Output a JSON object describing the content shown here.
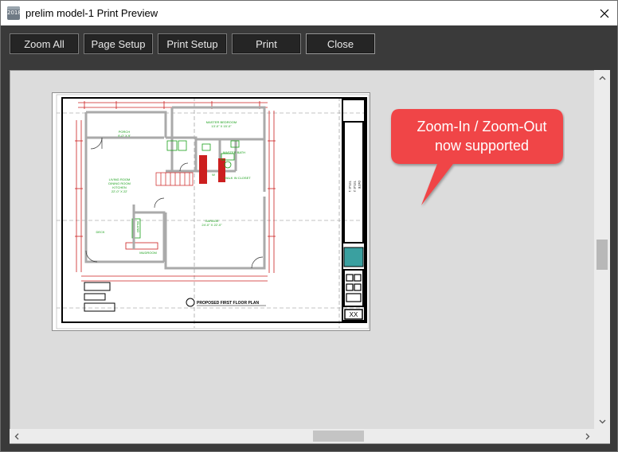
{
  "window": {
    "title": "prelim model-1 Print Preview",
    "app_icon_text": "2018"
  },
  "toolbar": {
    "zoom_all": "Zoom All",
    "page_setup": "Page Setup",
    "print_setup": "Print Setup",
    "print": "Print",
    "close": "Close"
  },
  "plan": {
    "rooms": {
      "porch": "PORCH",
      "porch_size": "9'-0\" X 9'",
      "master_bedroom": "MASTER BEDROOM",
      "master_bedroom_size": "13'-0\" X 15'-0\"",
      "master_bath": "MASTER BATH",
      "living_room": "LIVING ROOM",
      "dining_room": "DINING ROOM",
      "kitchen": "KITCHEN",
      "living_size": "22'-0\" X 22'",
      "walk_in_closet": "WALK IN CLOSET",
      "w": "W",
      "deck": "DECK",
      "garage": "GARAGE",
      "garage_size": "24'-0\" X 22'-0\"",
      "island": "ISLAND",
      "mudroom": "MUDROOM"
    },
    "plan_title": "PROPOSED FIRST FLOOR PLAN",
    "title_block_lines": [
      "TITLE 1",
      "TITLE 2",
      "DATE"
    ],
    "sheet_number": "XX"
  },
  "callout": {
    "line1": "Zoom-In / Zoom-Out",
    "line2": "now supported",
    "color": "#f04447"
  },
  "colors": {
    "toolbar_bg": "#3a3a3a",
    "viewport_bg": "#dcdcdc",
    "wall_red": "#cc1f1f",
    "label_green": "#1aa01a"
  }
}
